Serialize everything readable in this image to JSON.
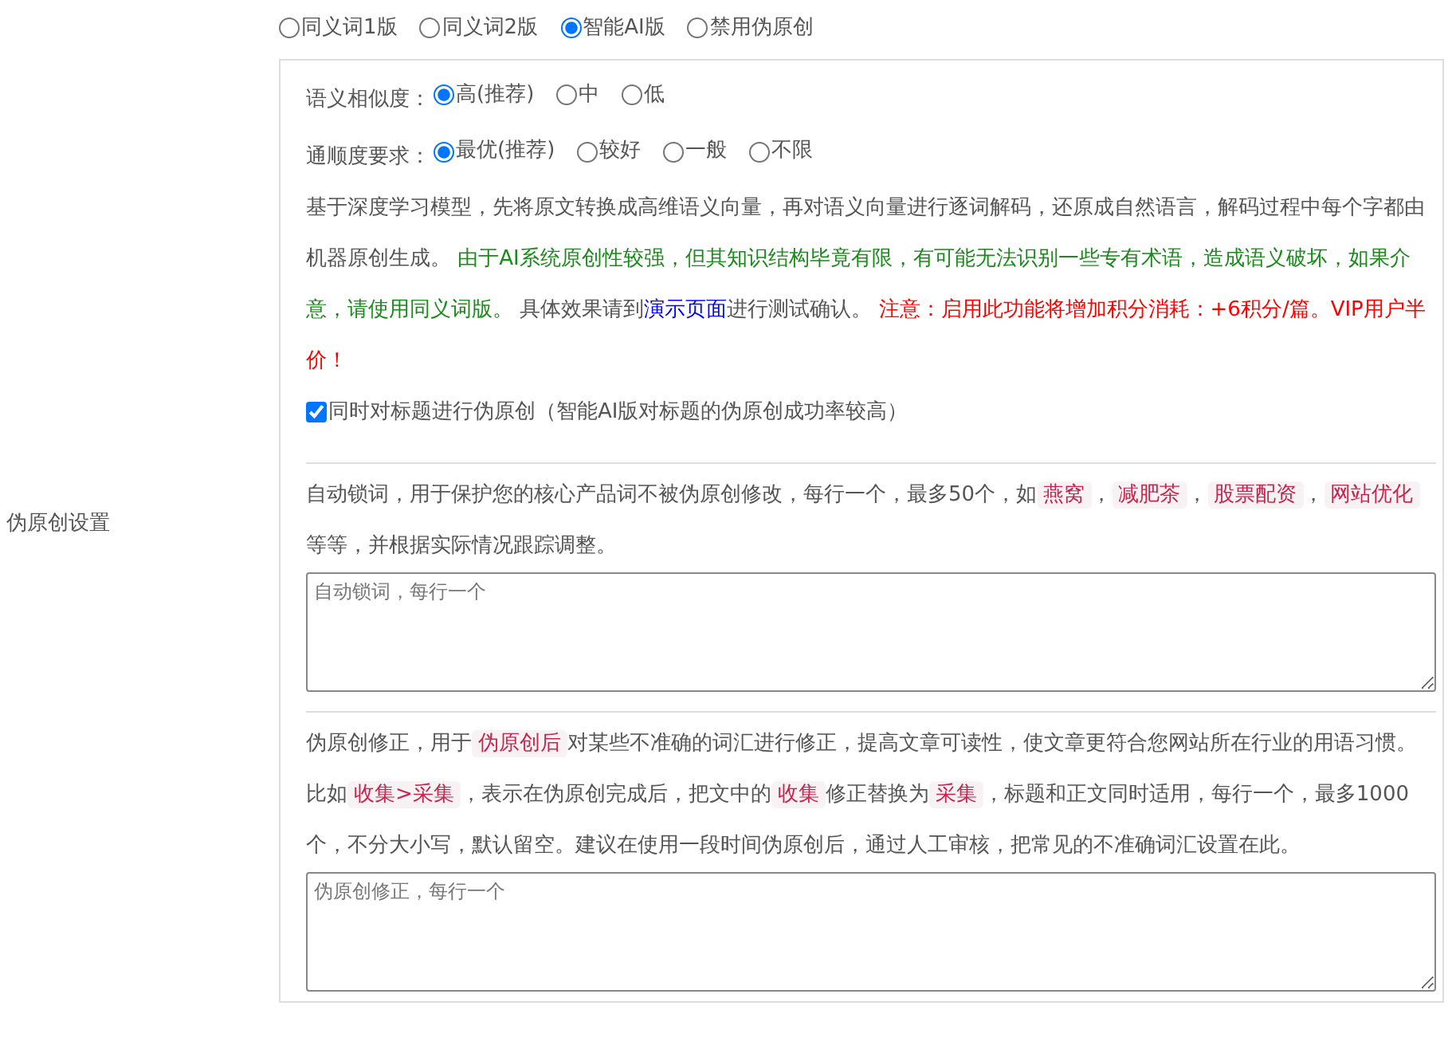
{
  "setting_label": "伪原创设置",
  "modes": [
    {
      "label": "同义词1版",
      "selected": false
    },
    {
      "label": "同义词2版",
      "selected": false
    },
    {
      "label": "智能AI版",
      "selected": true
    },
    {
      "label": "禁用伪原创",
      "selected": false
    }
  ],
  "similarity": {
    "label": "语义相似度：",
    "options": [
      {
        "label": "高(推荐)",
        "selected": true
      },
      {
        "label": "中",
        "selected": false
      },
      {
        "label": "低",
        "selected": false
      }
    ]
  },
  "fluency": {
    "label": "通顺度要求：",
    "options": [
      {
        "label": "最优(推荐)",
        "selected": true
      },
      {
        "label": "较好",
        "selected": false
      },
      {
        "label": "一般",
        "selected": false
      },
      {
        "label": "不限",
        "selected": false
      }
    ]
  },
  "ai_description": [
    {
      "kind": "plain",
      "text": "基于深度学习模型，先将原文转换成高维语义向量，再对语义向量进行逐词解码，还原成自然语言，解码过程中每个字都由机器原创生成。 "
    },
    {
      "kind": "warning",
      "text": "由于AI系统原创性较强，但其知识结构毕竟有限，有可能无法识别一些专有术语，造成语义破坏，如果介意，请使用同义词版。"
    },
    {
      "kind": "plain",
      "text": " 具体效果请到"
    },
    {
      "kind": "link",
      "text": "演示页面"
    },
    {
      "kind": "plain",
      "text": "进行测试确认。 "
    },
    {
      "kind": "alert",
      "text": "注意：启用此功能将增加积分消耗：+6积分/篇。VIP用户半价！"
    }
  ],
  "title_option": {
    "label": "同时对标题进行伪原创（智能AI版对标题的伪原创成功率较高）",
    "checked": true
  },
  "lock_words": {
    "description": [
      {
        "kind": "plain",
        "text": "自动锁词，用于保护您的核心产品词不被伪原创修改，每行一个，最多50个，如"
      },
      {
        "kind": "code",
        "text": "燕窝"
      },
      {
        "kind": "plain",
        "text": "，"
      },
      {
        "kind": "code",
        "text": "减肥茶"
      },
      {
        "kind": "plain",
        "text": "，"
      },
      {
        "kind": "code",
        "text": "股票配资"
      },
      {
        "kind": "plain",
        "text": "，"
      },
      {
        "kind": "code",
        "text": "网站优化"
      },
      {
        "kind": "plain",
        "text": " 等等，并根据实际情况跟踪调整。"
      }
    ],
    "placeholder": "自动锁词，每行一个"
  },
  "corrections": {
    "description": [
      {
        "kind": "plain",
        "text": "伪原创修正，用于"
      },
      {
        "kind": "code",
        "text": "伪原创后"
      },
      {
        "kind": "plain",
        "text": "对某些不准确的词汇进行修正，提高文章可读性，使文章更符合您网站所在行业的用语习惯。比如"
      },
      {
        "kind": "code",
        "text": "收集>采集"
      },
      {
        "kind": "plain",
        "text": "，表示在伪原创完成后，把文中的"
      },
      {
        "kind": "code",
        "text": "收集"
      },
      {
        "kind": "plain",
        "text": "修正替换为"
      },
      {
        "kind": "code",
        "text": "采集"
      },
      {
        "kind": "plain",
        "text": "，标题和正文同时适用，每行一个，最多1000个，不分大小写，默认留空。建议在使用一段时间伪原创后，通过人工审核，把常见的不准确词汇设置在此。"
      }
    ],
    "placeholder": "伪原创修正，每行一个"
  }
}
